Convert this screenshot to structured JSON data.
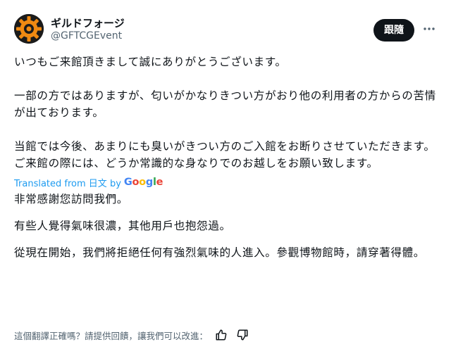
{
  "account": {
    "name": "ギルドフォージ",
    "handle": "@GFTCGEvent"
  },
  "follow_button": {
    "label": "跟隨"
  },
  "more_menu": {
    "icon": "more-horizontal-icon"
  },
  "original_text": [
    "いつもご来館頂きまして誠にありがとうございます。",
    "一部の方ではありますが、匂いがかなりきつい方がおり他の利用者の方からの苦情が出ております。",
    "当館では今後、あまりにも臭いがきつい方のご入館をお断りさせていただきます。ご来館の際には、どうか常識的な身なりでのお越しをお願い致します。"
  ],
  "translation": {
    "prefix": "Translated from ",
    "language": "日文",
    "by": " by ",
    "provider": [
      "G",
      "o",
      "o",
      "g",
      "l",
      "e"
    ],
    "text": [
      "非常感謝您訪問我們。",
      "有些人覺得氣味很濃，其他用戶也抱怨過。",
      "從現在開始，我們將拒絕任何有強烈氣味的人進入。參觀博物館時，請穿著得體。"
    ]
  },
  "feedback": {
    "prompt": "這個翻譯正確嗎？請提供回饋，讓我們可以改進：",
    "thumbs_up_icon": "thumbs-up-icon",
    "thumbs_down_icon": "thumbs-down-icon"
  }
}
